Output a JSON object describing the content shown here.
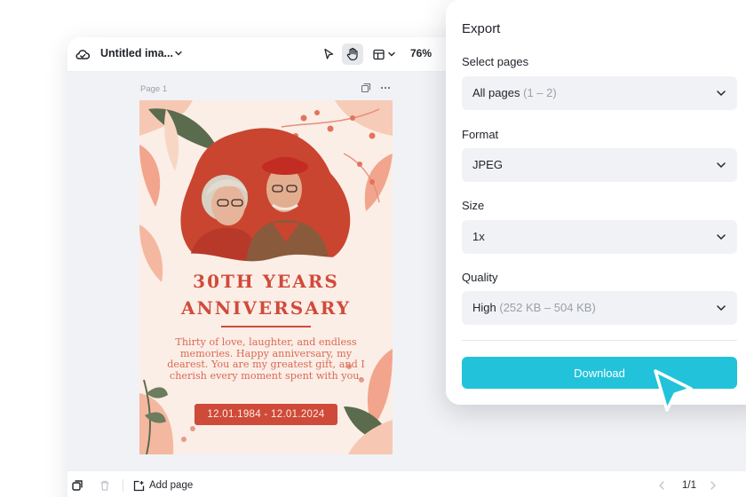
{
  "editor": {
    "doc_title": "Untitled ima...",
    "zoom": "76%",
    "page_label": "Page 1",
    "tools": [
      "select-pointer-icon",
      "hand-pan-icon",
      "layout-icon"
    ]
  },
  "card": {
    "title_line1": "30TH YEARS",
    "title_line2": "ANNIVERSARY",
    "message": "Thirty of love, laughter, and endless memories. Happy anniversary, my dearest. You are my greatest gift, and I cherish every moment spent with you.",
    "dates": "12.01.1984 - 12.01.2024",
    "photo": "elderly-couple-photo",
    "colors": {
      "accent": "#d14a3a",
      "background": "#fbeee6"
    }
  },
  "bottombar": {
    "add_page_label": "Add page",
    "pager": "1/1"
  },
  "export": {
    "title": "Export",
    "select_pages": {
      "label": "Select pages",
      "value": "All pages",
      "hint": "(1 – 2)"
    },
    "format": {
      "label": "Format",
      "value": "JPEG"
    },
    "size": {
      "label": "Size",
      "value": "1x"
    },
    "quality": {
      "label": "Quality",
      "value": "High",
      "hint": "(252 KB – 504 KB)"
    },
    "download_label": "Download",
    "colors": {
      "download_bg": "#22c3da",
      "field_bg": "#f1f2f5"
    }
  }
}
